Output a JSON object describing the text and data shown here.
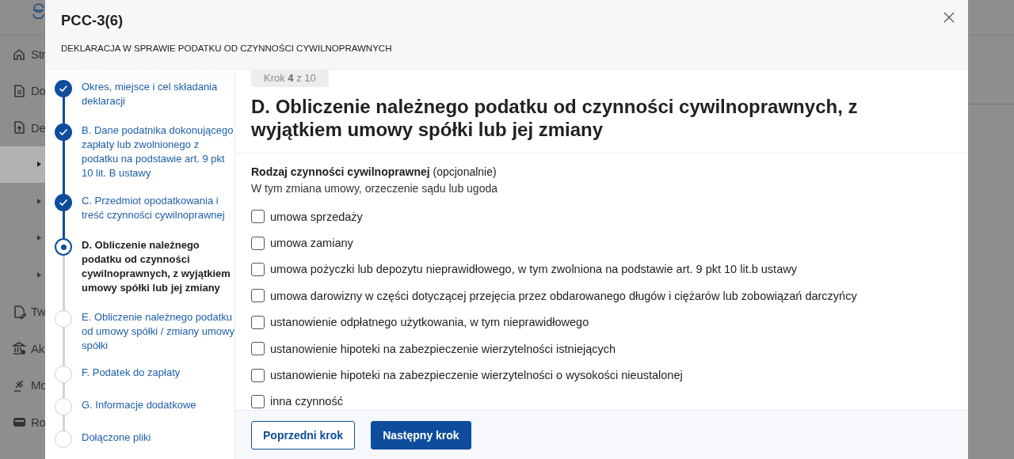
{
  "sidebar": {
    "items": [
      {
        "kind": "item",
        "label": "Str",
        "selected": false
      },
      {
        "kind": "item",
        "label": "Do",
        "selected": false
      },
      {
        "kind": "item",
        "label": "De",
        "selected": false
      },
      {
        "kind": "subitem",
        "selected": true
      },
      {
        "kind": "subitem",
        "selected": false
      },
      {
        "kind": "subitem",
        "selected": false
      },
      {
        "kind": "subitem",
        "selected": false
      },
      {
        "kind": "item",
        "label": "Tw",
        "selected": false
      },
      {
        "kind": "item",
        "label": "Ak",
        "selected": false
      },
      {
        "kind": "item",
        "label": "Mo",
        "selected": false
      },
      {
        "kind": "item",
        "label": "Ro",
        "selected": false
      }
    ]
  },
  "modal": {
    "title": "PCC-3(6)",
    "subtitle": "DEKLARACJA W SPRAWIE PODATKU OD CZYNNOŚCI CYWILNOPRAWNYCH",
    "steps": [
      {
        "label": "Okres, miejsce i cel składania deklaracji",
        "completed": true,
        "selected": false
      },
      {
        "label": "B. Dane podatnika dokonującego zapłaty lub zwolnionego z podatku na podstawie art. 9 pkt 10 lit. B ustawy",
        "completed": true,
        "selected": false
      },
      {
        "label": "C. Przedmiot opodatkowania i treść czynności cywilnoprawnej",
        "completed": true,
        "selected": false
      },
      {
        "label": "D. Obliczenie należnego podatku od czynności cywilnoprawnych, z wyjątkiem umowy spółki lub jej zmiany",
        "completed": false,
        "selected": true
      },
      {
        "label": "E. Obliczenie należnego podatku od umowy spółki / zmiany umowy spółki",
        "completed": false,
        "selected": false
      },
      {
        "label": "F. Podatek do zapłaty",
        "completed": false,
        "selected": false
      },
      {
        "label": "G. Informacje dodatkowe",
        "completed": false,
        "selected": false
      },
      {
        "label": "Dołączone pliki",
        "completed": false,
        "selected": false
      }
    ],
    "step_counter": "Krok **4** z 10",
    "heading": "D. Obliczenie należnego podatku od czynności cywilnoprawnych, z wyjątkiem umowy spółki lub jej zmiany",
    "field_label": "**Rodzaj czynności cywilnoprawnej** (opcjonalnie)",
    "field_hint": "W tym zmiana umowy, orzeczenie sądu lub ugoda",
    "options": [
      {
        "label": "umowa sprzedaży",
        "checked": false
      },
      {
        "label": "umowa zamiany",
        "checked": false
      },
      {
        "label": "umowa pożyczki lub depozytu nieprawidłowego, w tym zwolniona na podstawie art. 9 pkt 10 lit.b ustawy",
        "checked": false
      },
      {
        "label": "umowa darowizny w części dotyczącej przejęcia przez obdarowanego długów i ciężarów lub zobowiązań darczyńcy",
        "checked": false
      },
      {
        "label": "ustanowienie odpłatnego użytkowania, w tym nieprawidłowego",
        "checked": false
      },
      {
        "label": "ustanowienie hipoteki na zabezpieczenie wierzytelności istniejących",
        "checked": false
      },
      {
        "label": "ustanowienie hipoteki na zabezpieczenie wierzytelności o wysokości nieustalonej",
        "checked": false
      },
      {
        "label": "inna czynność",
        "checked": false
      }
    ],
    "buttons": [
      {
        "label": "Poprzedni krok",
        "kind": "secondary"
      },
      {
        "label": "Następny krok",
        "kind": "primary"
      }
    ]
  }
}
